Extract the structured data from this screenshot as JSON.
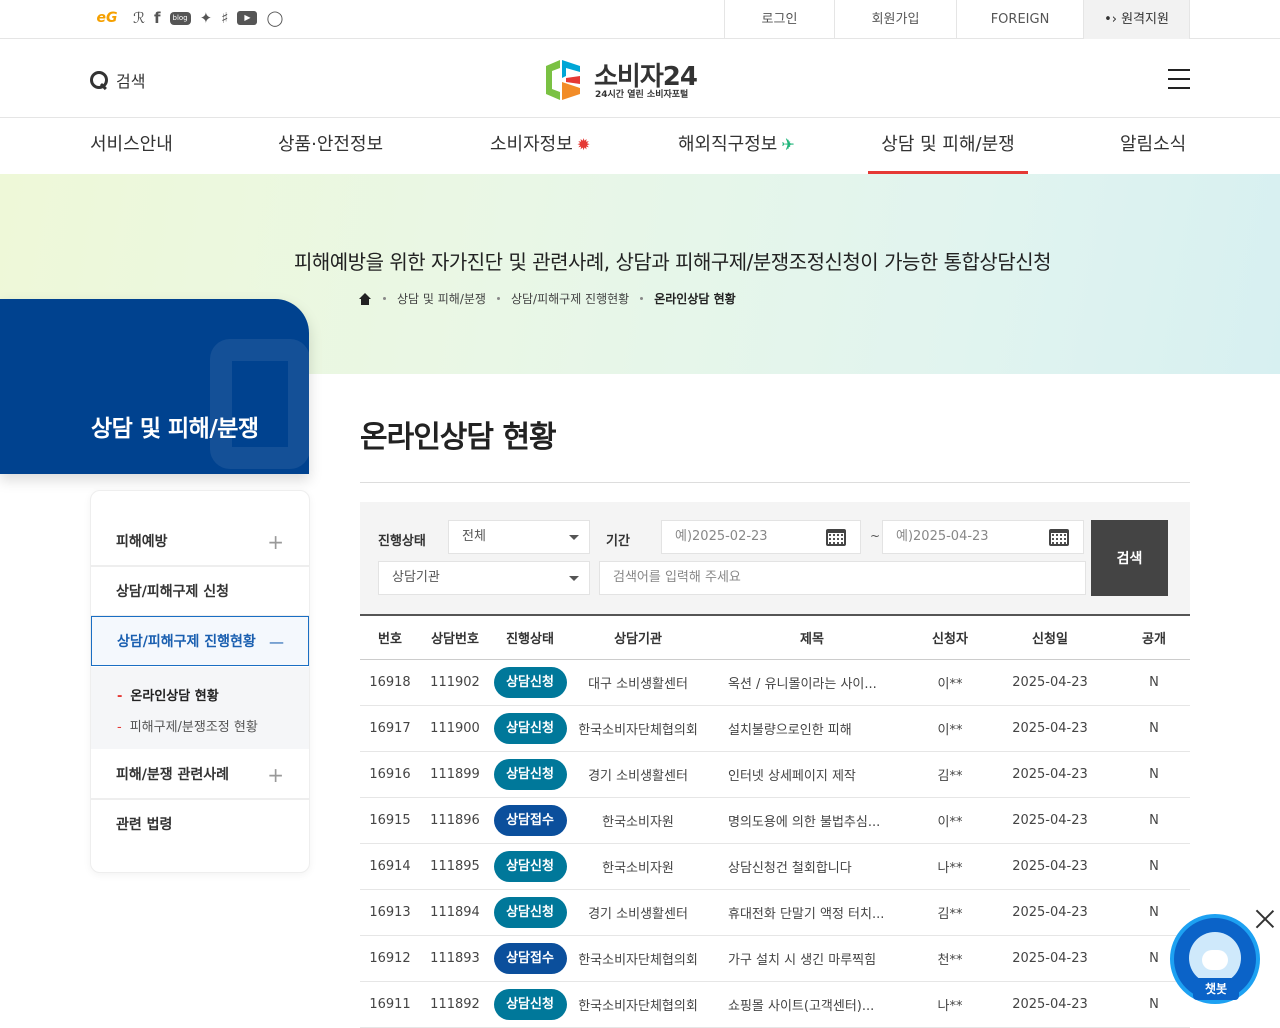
{
  "util": {
    "sns": [
      "eG",
      "rss",
      "facebook",
      "blog",
      "twitter",
      "story",
      "youtube",
      "instagram"
    ],
    "sns_eg": "eG",
    "sns_blog": "blog",
    "login": "로그인",
    "join": "회원가입",
    "foreign": "FOREIGN",
    "remote": "원격지원"
  },
  "header": {
    "search_label": "검색",
    "logo_text": "소비자24",
    "logo_sub": "24시간 열린 소비자포털"
  },
  "gnb": {
    "items": [
      "서비스안내",
      "상품·안전정보",
      "소비자정보",
      "해외직구정보",
      "상담 및 피해/분쟁",
      "알림소식"
    ],
    "active_index": 4
  },
  "hero": {
    "title": "피해예방을 위한 자가진단 및 관련사례, 상담과 피해구제/분쟁조정신청이 가능한 통합상담신청",
    "breadcrumb": [
      "상담 및 피해/분쟁",
      "상담/피해구제 진행현황",
      "온라인상담 현황"
    ]
  },
  "side": {
    "title": "상담 및 피해/분쟁",
    "menu": [
      "피해예방",
      "상담/피해구제 신청",
      "상담/피해구제 진행현황",
      "피해/분쟁 관련사례",
      "관련 법령"
    ],
    "sub": [
      "온라인상담 현황",
      "피해구제/분쟁조정 현황"
    ],
    "plus": "+",
    "minus": "—"
  },
  "main": {
    "title": "온라인상담 현황"
  },
  "filter": {
    "status_label": "진행상태",
    "status_value": "전체",
    "period_label": "기간",
    "start_placeholder": "예)2025-02-23",
    "tilde": "~",
    "end_placeholder": "예)2025-04-23",
    "agency_value": "상담기관",
    "keyword_placeholder": "검색어를 입력해 주세요",
    "search_button": "검색"
  },
  "table": {
    "headers": [
      "번호",
      "상담번호",
      "진행상태",
      "상담기관",
      "제목",
      "신청자",
      "신청일",
      "공개"
    ],
    "rows": [
      [
        "16918",
        "111902",
        "상담신청",
        "대구 소비생활센터",
        "옥션 / 유니몰이라는 사이...",
        "이**",
        "2025-04-23",
        "N"
      ],
      [
        "16917",
        "111900",
        "상담신청",
        "한국소비자단체협의회",
        "설치불량으로인한 피해",
        "이**",
        "2025-04-23",
        "N"
      ],
      [
        "16916",
        "111899",
        "상담신청",
        "경기 소비생활센터",
        "인터넷 상세페이지 제작",
        "김**",
        "2025-04-23",
        "N"
      ],
      [
        "16915",
        "111896",
        "상담접수",
        "한국소비자원",
        "명의도용에 의한 불법추심...",
        "이**",
        "2025-04-23",
        "N"
      ],
      [
        "16914",
        "111895",
        "상담신청",
        "한국소비자원",
        "상담신청건 철회합니다",
        "나**",
        "2025-04-23",
        "N"
      ],
      [
        "16913",
        "111894",
        "상담신청",
        "경기 소비생활센터",
        "휴대전화 단말기 액정 터치...",
        "김**",
        "2025-04-23",
        "N"
      ],
      [
        "16912",
        "111893",
        "상담접수",
        "한국소비자단체협의회",
        "가구 설치 시 생긴 마루찍힘",
        "천**",
        "2025-04-23",
        "N"
      ],
      [
        "16911",
        "111892",
        "상담신청",
        "한국소비자단체협의회",
        "쇼핑몰 사이트(고객센터)...",
        "나**",
        "2025-04-23",
        "N"
      ]
    ]
  },
  "chatbot": {
    "label": "챗봇"
  },
  "colors": {
    "accent_red": "#e53935",
    "navy": "#00428f",
    "badge_request": "#00789a",
    "badge_accepted": "#0b4f9c",
    "public_flag": "#ff4d00"
  }
}
